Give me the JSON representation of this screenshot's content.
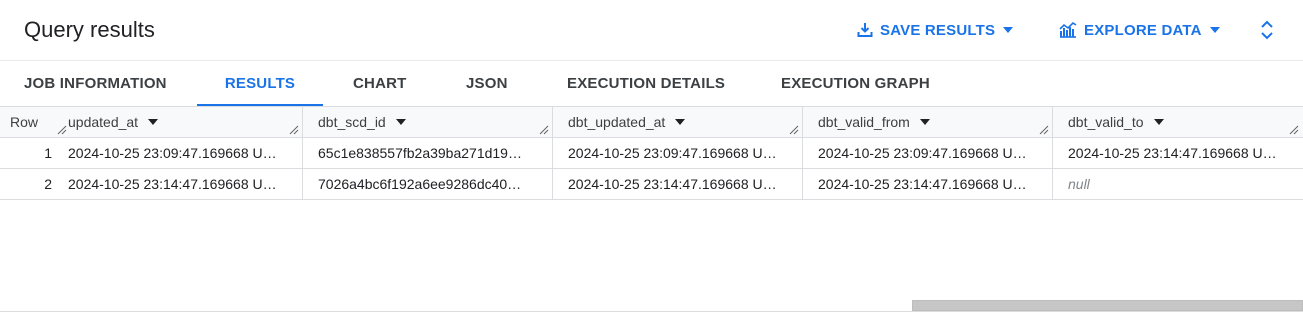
{
  "header": {
    "title": "Query results",
    "save_results_label": "SAVE RESULTS",
    "explore_data_label": "EXPLORE DATA",
    "accent_color": "#1a73e8"
  },
  "tabs": [
    {
      "label": "JOB INFORMATION",
      "active": false
    },
    {
      "label": "RESULTS",
      "active": true
    },
    {
      "label": "CHART",
      "active": false
    },
    {
      "label": "JSON",
      "active": false
    },
    {
      "label": "EXECUTION DETAILS",
      "active": false
    },
    {
      "label": "EXECUTION GRAPH",
      "active": false
    }
  ],
  "table": {
    "row_header": "Row",
    "columns": [
      "updated_at",
      "dbt_scd_id",
      "dbt_updated_at",
      "dbt_valid_from",
      "dbt_valid_to"
    ],
    "rows": [
      {
        "row": "1",
        "cells": [
          "2024-10-25 23:09:47.169668 U…",
          "65c1e838557fb2a39ba271d19…",
          "2024-10-25 23:09:47.169668 U…",
          "2024-10-25 23:09:47.169668 U…",
          "2024-10-25 23:14:47.169668 U…"
        ]
      },
      {
        "row": "2",
        "cells": [
          "2024-10-25 23:14:47.169668 U…",
          "7026a4bc6f192a6ee9286dc40…",
          "2024-10-25 23:14:47.169668 U…",
          "2024-10-25 23:14:47.169668 U…",
          "null"
        ]
      }
    ]
  },
  "icons": {
    "save": "download-icon",
    "explore": "chart-icon",
    "expand": "unfold-icon"
  }
}
